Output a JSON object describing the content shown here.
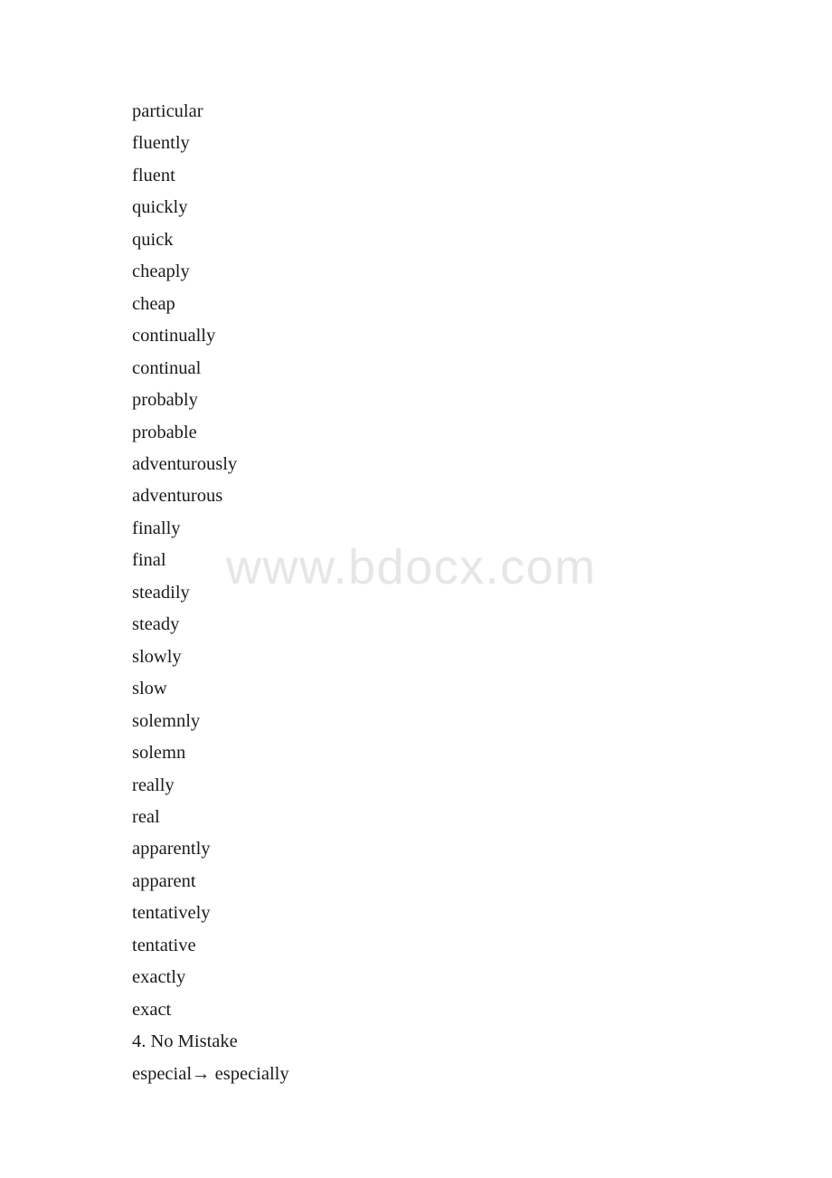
{
  "document": {
    "watermark": "www.bdocx.com",
    "watermark_color": "#e6e6e6",
    "text_color": "#1b1b1b",
    "background_color": "#ffffff",
    "lines": [
      {
        "text": "particular"
      },
      {
        "text": "fluently"
      },
      {
        "text": "fluent"
      },
      {
        "text": "quickly"
      },
      {
        "text": "quick"
      },
      {
        "text": "cheaply"
      },
      {
        "text": "cheap"
      },
      {
        "text": "continually"
      },
      {
        "text": "continual"
      },
      {
        "text": "probably"
      },
      {
        "text": "probable"
      },
      {
        "text": "adventurously"
      },
      {
        "text": "adventurous"
      },
      {
        "text": "finally"
      },
      {
        "text": "final"
      },
      {
        "text": "steadily"
      },
      {
        "text": "steady"
      },
      {
        "text": "slowly"
      },
      {
        "text": "slow"
      },
      {
        "text": "solemnly"
      },
      {
        "text": "solemn"
      },
      {
        "text": "really"
      },
      {
        "text": "real"
      },
      {
        "text": "apparently"
      },
      {
        "text": "apparent"
      },
      {
        "text": "tentatively"
      },
      {
        "text": "tentative"
      },
      {
        "text": "exactly"
      },
      {
        "text": "exact"
      },
      {
        "text": "4. No Mistake"
      },
      {
        "text": "especial→ especially"
      }
    ]
  }
}
